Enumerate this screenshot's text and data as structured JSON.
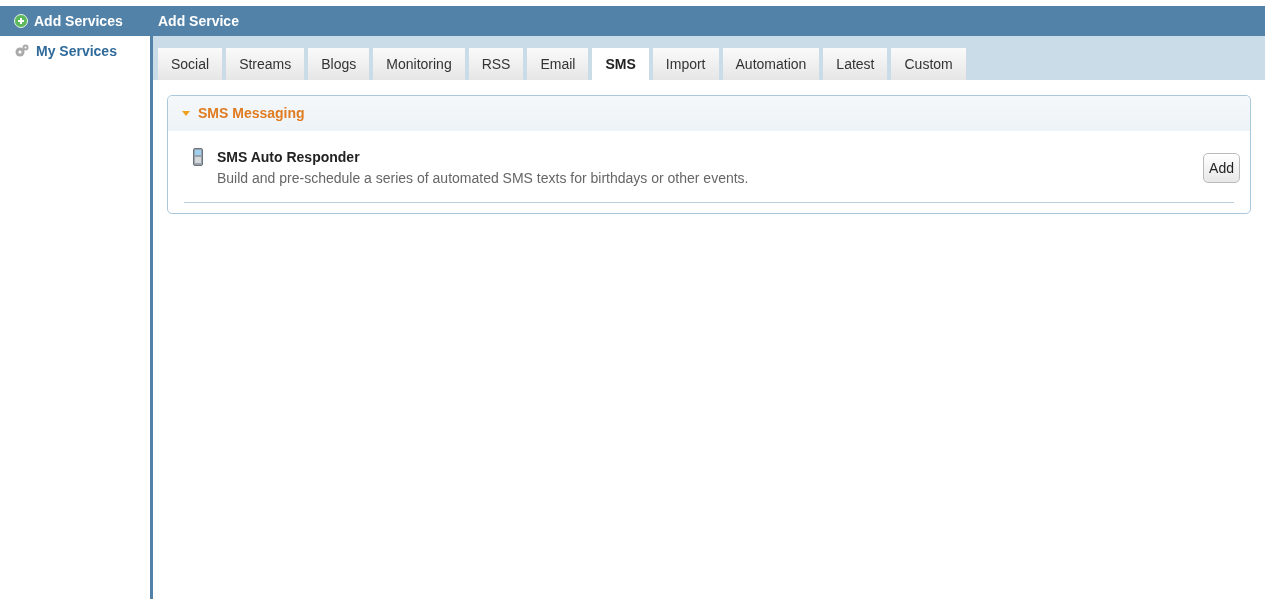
{
  "sidebar": {
    "items": [
      {
        "label": "Add Services",
        "selected": true,
        "kind": "add"
      },
      {
        "label": "My Services",
        "selected": false,
        "kind": "gear"
      }
    ]
  },
  "panel": {
    "title": "Add Service",
    "tabs": [
      {
        "label": "Social",
        "selected": false
      },
      {
        "label": "Streams",
        "selected": false
      },
      {
        "label": "Blogs",
        "selected": false
      },
      {
        "label": "Monitoring",
        "selected": false
      },
      {
        "label": "RSS",
        "selected": false
      },
      {
        "label": "Email",
        "selected": false
      },
      {
        "label": "SMS",
        "selected": true
      },
      {
        "label": "Import",
        "selected": false
      },
      {
        "label": "Automation",
        "selected": false
      },
      {
        "label": "Latest",
        "selected": false
      },
      {
        "label": "Custom",
        "selected": false
      }
    ],
    "section": {
      "title": "SMS Messaging",
      "expanded": true,
      "services": [
        {
          "name": "SMS Auto Responder",
          "description": "Build and pre-schedule a series of automated SMS texts for birthdays or other events.",
          "button": "Add"
        }
      ]
    }
  }
}
